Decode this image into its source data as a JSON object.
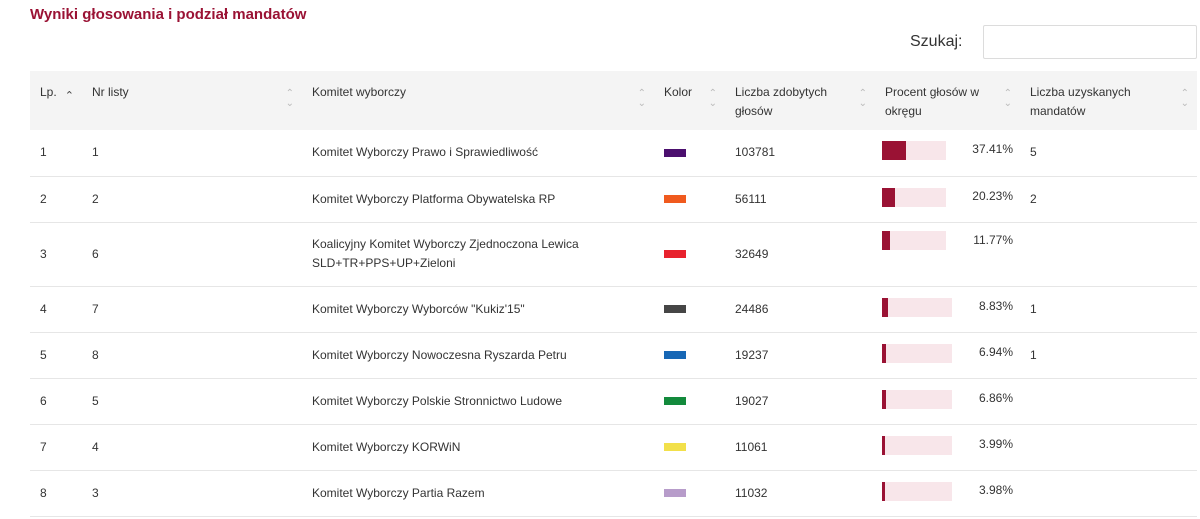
{
  "title": "Wyniki głosowania i podział mandatów",
  "search": {
    "label": "Szukaj:",
    "value": ""
  },
  "columns": [
    "Lp.",
    "Nr listy",
    "Komitet wyborczy",
    "Kolor",
    "Liczba zdobytych głosów",
    "Procent głosów w okręgu",
    "Liczba uzyskanych mandatów"
  ],
  "colors": {
    "accent": "#9a1234",
    "bar_track": "#f8e6ea"
  },
  "rows": [
    {
      "lp": "1",
      "list": "1",
      "committee": "Komitet Wyborczy Prawo i Sprawiedliwość",
      "color": "#4b0f6e",
      "votes": "103781",
      "percent": "37.41%",
      "pct": 37.41,
      "seats": "5"
    },
    {
      "lp": "2",
      "list": "2",
      "committee": "Komitet Wyborczy Platforma Obywatelska RP",
      "color": "#f05a1e",
      "votes": "56111",
      "percent": "20.23%",
      "pct": 20.23,
      "seats": "2"
    },
    {
      "lp": "3",
      "list": "6",
      "committee": "Koalicyjny Komitet Wyborczy Zjednoczona Lewica SLD+TR+PPS+UP+Zieloni",
      "color": "#e8222d",
      "votes": "32649",
      "percent": "11.77%",
      "pct": 11.77,
      "seats": ""
    },
    {
      "lp": "4",
      "list": "7",
      "committee": "Komitet Wyborczy Wyborców \"Kukiz'15\"",
      "color": "#464646",
      "votes": "24486",
      "percent": "8.83%",
      "pct": 8.83,
      "seats": "1"
    },
    {
      "lp": "5",
      "list": "8",
      "committee": "Komitet Wyborczy Nowoczesna Ryszarda Petru",
      "color": "#1767b5",
      "votes": "19237",
      "percent": "6.94%",
      "pct": 6.94,
      "seats": "1"
    },
    {
      "lp": "6",
      "list": "5",
      "committee": "Komitet Wyborczy Polskie Stronnictwo Ludowe",
      "color": "#138a3c",
      "votes": "19027",
      "percent": "6.86%",
      "pct": 6.86,
      "seats": ""
    },
    {
      "lp": "7",
      "list": "4",
      "committee": "Komitet Wyborczy KORWiN",
      "color": "#f2e04a",
      "votes": "11061",
      "percent": "3.99%",
      "pct": 3.99,
      "seats": ""
    },
    {
      "lp": "8",
      "list": "3",
      "committee": "Komitet Wyborczy Partia Razem",
      "color": "#b79cca",
      "votes": "11032",
      "percent": "3.98%",
      "pct": 3.98,
      "seats": ""
    }
  ]
}
